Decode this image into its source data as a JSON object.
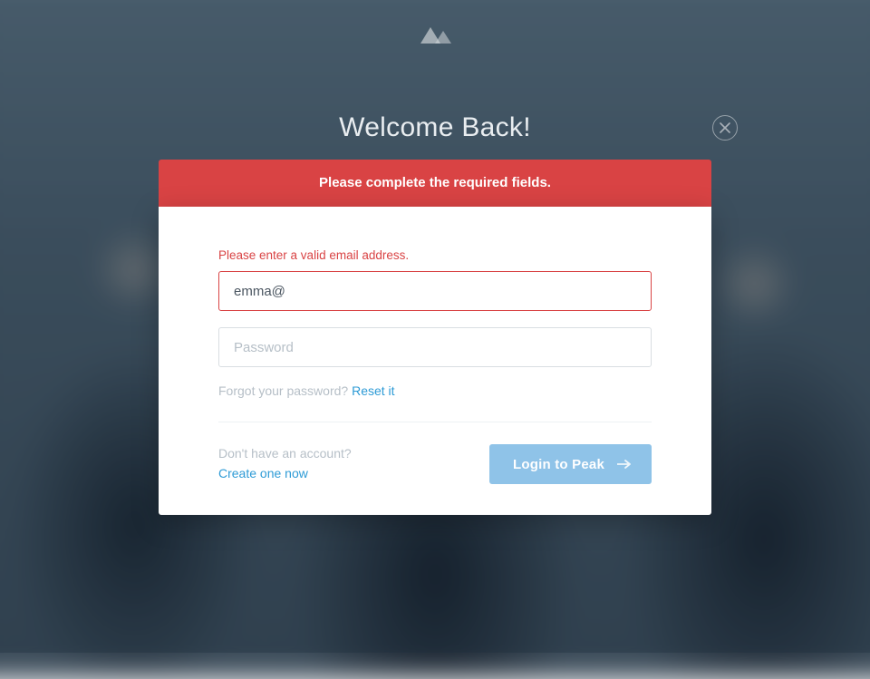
{
  "colors": {
    "accent": "#2e9bd6",
    "danger": "#d94344",
    "button": "#8fc3e8"
  },
  "header": {
    "title": "Welcome Back!"
  },
  "alert": {
    "message": "Please complete the required fields."
  },
  "form": {
    "email_error": "Please enter a valid email address.",
    "email_value": "emma@",
    "password_placeholder": "Password",
    "password_value": ""
  },
  "links": {
    "forgot_prefix": "Forgot your password? ",
    "forgot_action": "Reset it",
    "signup_question": "Don't have an account?",
    "signup_action": "Create one now"
  },
  "button": {
    "login_label": "Login to Peak"
  },
  "icons": {
    "logo": "mountains-icon",
    "close": "close-icon",
    "arrow": "arrow-right-icon"
  }
}
